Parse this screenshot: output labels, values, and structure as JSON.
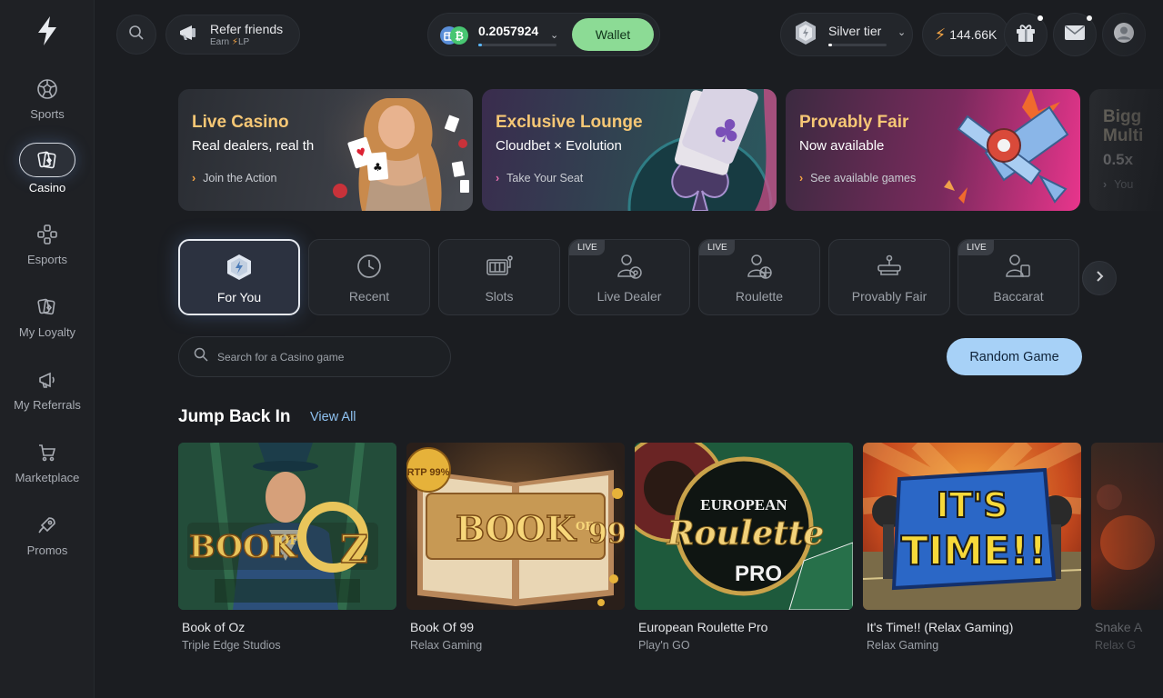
{
  "sidebar": {
    "items": [
      {
        "label": "Sports"
      },
      {
        "label": "Casino"
      },
      {
        "label": "Esports"
      },
      {
        "label": "My Loyalty"
      },
      {
        "label": "My Referrals"
      },
      {
        "label": "Marketplace"
      },
      {
        "label": "Promos"
      }
    ]
  },
  "header": {
    "refer_title": "Refer friends",
    "refer_sub": "Earn",
    "refer_sub_unit": "LP",
    "balance": "0.2057924",
    "wallet_label": "Wallet",
    "tier_label": "Silver tier",
    "points": "144.66K"
  },
  "banners": [
    {
      "title": "Live Casino",
      "subtitle": "Real dealers, real th",
      "cta": "Join the Action"
    },
    {
      "title": "Exclusive Lounge",
      "subtitle": "Cloudbet × Evolution",
      "cta": "Take Your Seat"
    },
    {
      "title": "Provably Fair",
      "subtitle": "Now available",
      "cta": "See available games"
    },
    {
      "title": "Bigg",
      "title2": "Multi",
      "subtitle": "0.5x",
      "cta": "You"
    }
  ],
  "categories": [
    {
      "label": "For You",
      "icon": "cube-bolt-icon"
    },
    {
      "label": "Recent",
      "icon": "clock-icon"
    },
    {
      "label": "Slots",
      "icon": "slot-machine-icon"
    },
    {
      "label": "Live Dealer",
      "icon": "dealer-icon",
      "badge": "LIVE"
    },
    {
      "label": "Roulette",
      "icon": "roulette-dealer-icon",
      "badge": "LIVE"
    },
    {
      "label": "Provably Fair",
      "icon": "scale-icon"
    },
    {
      "label": "Baccarat",
      "icon": "baccarat-dealer-icon",
      "badge": "LIVE"
    }
  ],
  "search": {
    "placeholder": "Search for a Casino game"
  },
  "random_game_label": "Random Game",
  "section": {
    "title": "Jump Back In",
    "view_all": "View All"
  },
  "games": [
    {
      "name": "Book of Oz",
      "provider": "Triple Edge Studios"
    },
    {
      "name": "Book Of 99",
      "provider": "Relax Gaming",
      "badge": "RTP 99%"
    },
    {
      "name": "European Roulette Pro",
      "provider": "Play'n GO",
      "art1": "EUROPEAN",
      "art2": "Roulette",
      "art3": "PRO"
    },
    {
      "name": "It's Time!! (Relax Gaming)",
      "provider": "Relax Gaming",
      "art1": "IT'S",
      "art2": "TIME!!"
    },
    {
      "name": "Snake A",
      "provider": "Relax G"
    }
  ],
  "colors": {
    "background": "#1b1d21",
    "wallet_button": "#8cdb95",
    "random_button": "#a7d1f7",
    "banner_title": "#f6c775",
    "link": "#8ec1f0"
  }
}
